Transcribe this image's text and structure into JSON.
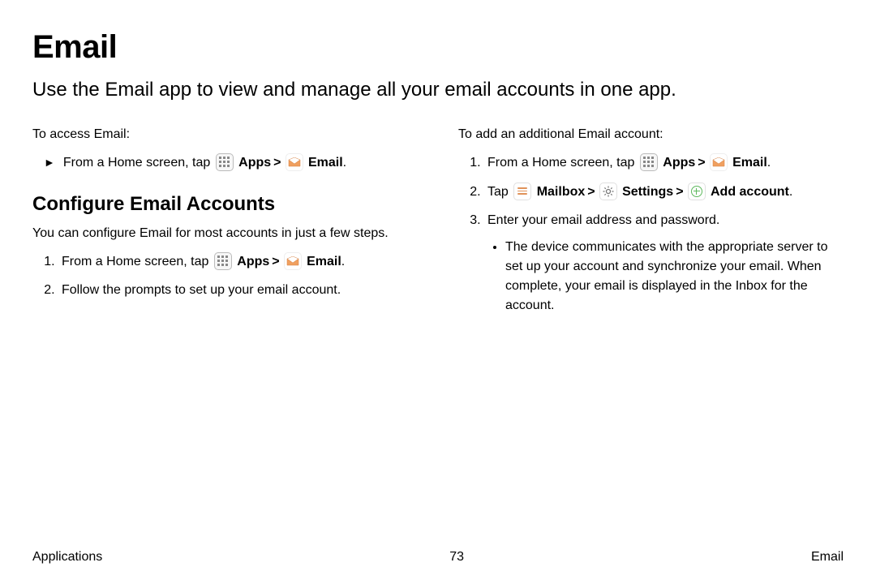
{
  "title": "Email",
  "intro": "Use the Email app to view and manage all your email accounts in one app.",
  "left": {
    "access_label": "To access Email:",
    "from_home": "From a Home screen, tap ",
    "apps_label": "Apps",
    "email_label": "Email",
    "section_heading": "Configure Email Accounts",
    "config_desc": "You can configure Email for most accounts in just a few steps.",
    "step2": "Follow the prompts to set up your email account."
  },
  "right": {
    "add_label": "To add an additional Email account:",
    "from_home": "From a Home screen, tap ",
    "apps_label": "Apps",
    "email_label": "Email",
    "tap_word": "Tap ",
    "mailbox_label": "Mailbox",
    "settings_label": "Settings",
    "add_account_label": "Add account",
    "step3": "Enter your email address and password.",
    "sub_bullet": "The device communicates with the appropriate server to set up your account and synchronize your email. When complete, your email is displayed in the Inbox for the account."
  },
  "separator": ">",
  "period": ".",
  "footer": {
    "left": "Applications",
    "center": "73",
    "right": "Email"
  }
}
